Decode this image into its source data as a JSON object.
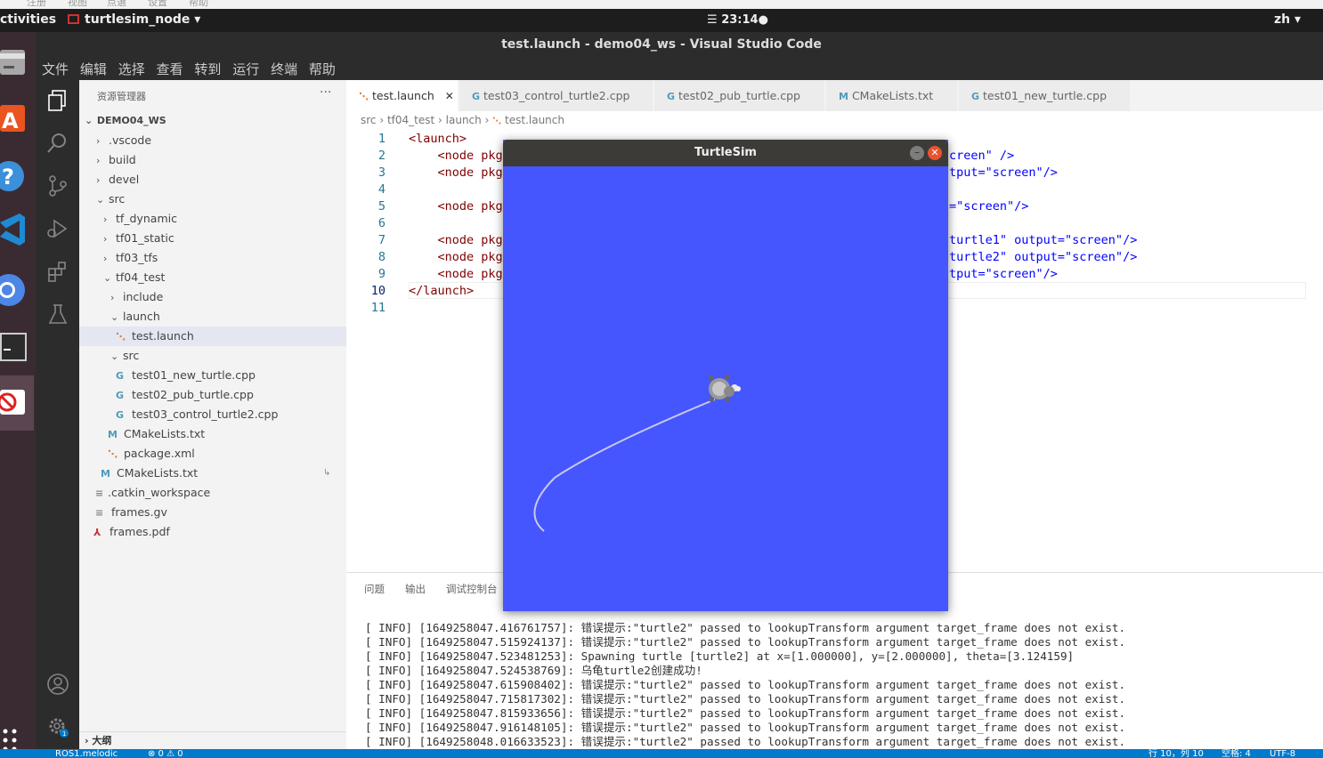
{
  "topbar": {
    "activities": "ctivities",
    "app_name": "turtlesim_node",
    "clock": "23:14",
    "language": "zh"
  },
  "window": {
    "title": "test.launch - demo04_ws - Visual Studio Code"
  },
  "menu": [
    "文件",
    "编辑",
    "选择",
    "查看",
    "转到",
    "运行",
    "终端",
    "帮助"
  ],
  "sidebar": {
    "title": "资源管理器",
    "more": "···",
    "workspace": "DEMO04_WS",
    "items": [
      {
        "label": ".vscode",
        "chev": "›"
      },
      {
        "label": "build",
        "chev": "›"
      },
      {
        "label": "devel",
        "chev": "›"
      },
      {
        "label": "src",
        "chev": "⌄"
      },
      {
        "label": "tf_dynamic",
        "chev": "›"
      },
      {
        "label": "tf01_static",
        "chev": "›"
      },
      {
        "label": "tf03_tfs",
        "chev": "›"
      },
      {
        "label": "tf04_test",
        "chev": "⌄"
      },
      {
        "label": "include",
        "chev": "›"
      },
      {
        "label": "launch",
        "chev": "⌄"
      },
      {
        "label": "test.launch",
        "icon": "rss"
      },
      {
        "label": "src",
        "chev": "⌄"
      },
      {
        "label": "test01_new_turtle.cpp",
        "icon": "C"
      },
      {
        "label": "test02_pub_turtle.cpp",
        "icon": "C"
      },
      {
        "label": "test03_control_turtle2.cpp",
        "icon": "C"
      },
      {
        "label": "CMakeLists.txt",
        "icon": "M"
      },
      {
        "label": "package.xml",
        "icon": "rss"
      },
      {
        "label": "CMakeLists.txt",
        "icon": "M"
      },
      {
        "label": ".catkin_workspace",
        "icon": "≡"
      },
      {
        "label": "frames.gv",
        "icon": "≡"
      },
      {
        "label": "frames.pdf",
        "icon": "pdf"
      }
    ],
    "outline": "大纲"
  },
  "tabs": [
    {
      "label": "test.launch",
      "icon": "rss",
      "close": "✕"
    },
    {
      "label": "test03_control_turtle2.cpp",
      "icon": "C"
    },
    {
      "label": "test02_pub_turtle.cpp",
      "icon": "C"
    },
    {
      "label": "CMakeLists.txt",
      "icon": "M"
    },
    {
      "label": "test01_new_turtle.cpp",
      "icon": "C"
    }
  ],
  "breadcrumb": [
    "src",
    "tf04_test",
    "launch",
    "test.launch"
  ],
  "editor": {
    "line_numbers": [
      "1",
      "2",
      "3",
      "4",
      "5",
      "6",
      "7",
      "8",
      "9",
      "10",
      "11"
    ],
    "lines": [
      {
        "left": "<launch>",
        "right": ""
      },
      {
        "left": "    <node pkg",
        "right": "creen\" />"
      },
      {
        "left": "    <node pkg",
        "right": "tput=\"screen\"/>"
      },
      {
        "left": "",
        "right": ""
      },
      {
        "left": "    <node pkg",
        "right": "=\"screen\"/>"
      },
      {
        "left": "",
        "right": ""
      },
      {
        "left": "    <node pkg",
        "right": "turtle1\" output=\"screen\"/>"
      },
      {
        "left": "    <node pkg",
        "right": "turtle2\" output=\"screen\"/>"
      },
      {
        "left": "    <node pkg",
        "right": "tput=\"screen\"/>"
      },
      {
        "left": "</launch>",
        "right": ""
      },
      {
        "left": "",
        "right": ""
      }
    ]
  },
  "panel": {
    "tabs": [
      "问题",
      "输出",
      "调试控制台"
    ],
    "terminal_lines": [
      "[ INFO] [1649258047.416761757]: 错误提示:\"turtle2\" passed to lookupTransform argument target_frame does not exist.",
      "[ INFO] [1649258047.515924137]: 错误提示:\"turtle2\" passed to lookupTransform argument target_frame does not exist.",
      "[ INFO] [1649258047.523481253]: Spawning turtle [turtle2] at x=[1.000000], y=[2.000000], theta=[3.124159]",
      "[ INFO] [1649258047.524538769]: 乌龟turtle2创建成功!",
      "[ INFO] [1649258047.615908402]: 错误提示:\"turtle2\" passed to lookupTransform argument target_frame does not exist.",
      "[ INFO] [1649258047.715817302]: 错误提示:\"turtle2\" passed to lookupTransform argument target_frame does not exist.",
      "[ INFO] [1649258047.815933656]: 错误提示:\"turtle2\" passed to lookupTransform argument target_frame does not exist.",
      "[ INFO] [1649258047.916148105]: 错误提示:\"turtle2\" passed to lookupTransform argument target_frame does not exist.",
      "[ INFO] [1649258048.016633523]: 错误提示:\"turtle2\" passed to lookupTransform argument target_frame does not exist."
    ]
  },
  "statusbar": {
    "left": "ROS1.melodic",
    "problems": "⊗ 0 ⚠ 0",
    "position": "行 10，列 10",
    "spaces": "空格: 4",
    "encoding": "UTF-8"
  },
  "turtlesim": {
    "title": "TurtleSim",
    "background": "#4556ff",
    "trail_color": "#c9c9e8"
  },
  "colors": {
    "accent": "#007acc",
    "selection": "#e4e6f1"
  }
}
